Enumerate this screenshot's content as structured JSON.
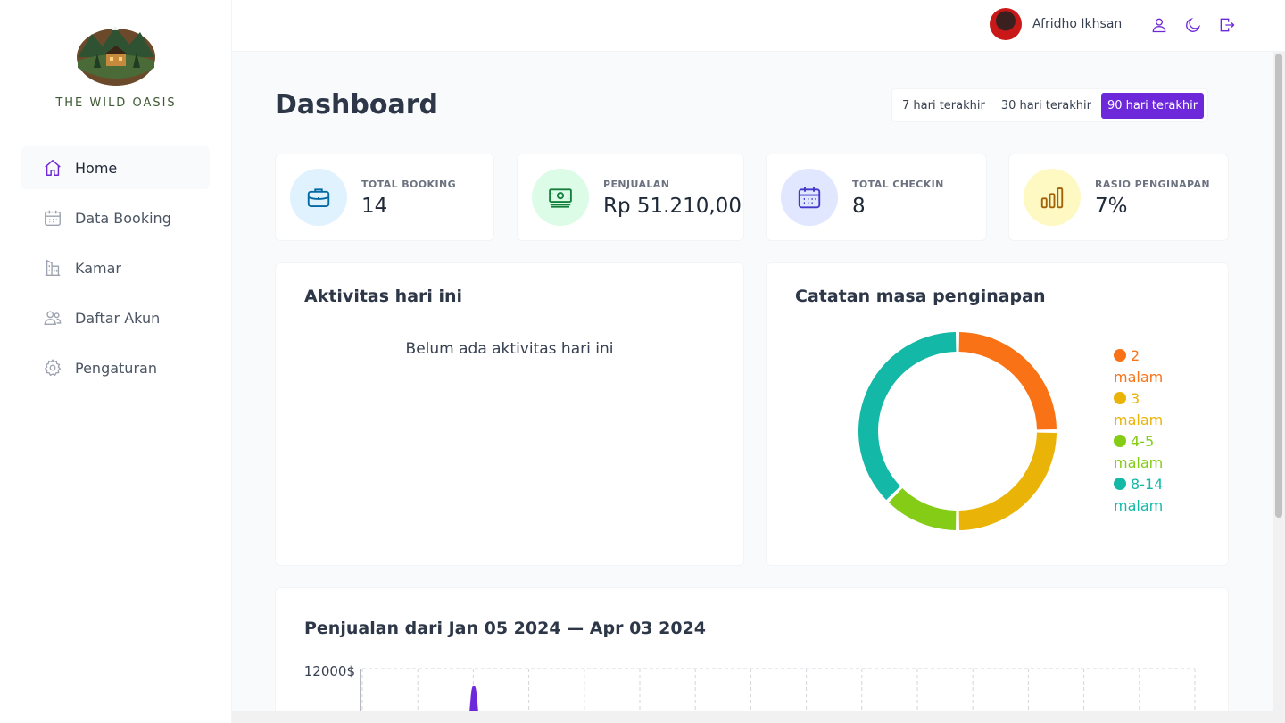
{
  "brand": {
    "name": "THE WILD OASIS"
  },
  "sidebar": {
    "items": [
      {
        "label": "Home",
        "icon": "home-icon",
        "active": true
      },
      {
        "label": "Data Booking",
        "icon": "calendar-icon",
        "active": false
      },
      {
        "label": "Kamar",
        "icon": "building-icon",
        "active": false
      },
      {
        "label": "Daftar Akun",
        "icon": "users-icon",
        "active": false
      },
      {
        "label": "Pengaturan",
        "icon": "gear-icon",
        "active": false
      }
    ]
  },
  "header": {
    "user_name": "Afridho Ikhsan",
    "icons": [
      "user-icon",
      "moon-icon",
      "logout-icon"
    ]
  },
  "page": {
    "title": "Dashboard"
  },
  "filter": {
    "options": [
      "7 hari terakhir",
      "30 hari terakhir",
      "90 hari terakhir"
    ],
    "selected": "90 hari terakhir"
  },
  "stats": [
    {
      "title": "TOTAL BOOKING",
      "value": "14",
      "icon": "briefcase-icon",
      "color": "#0369a1",
      "bg": "#e0f2fe"
    },
    {
      "title": "PENJUALAN",
      "value": "Rp 51.210,00",
      "icon": "banknotes-icon",
      "color": "#15803d",
      "bg": "#dcfce7"
    },
    {
      "title": "TOTAL CHECKIN",
      "value": "8",
      "icon": "calendar-days-icon",
      "color": "#4338ca",
      "bg": "#e0e7ff"
    },
    {
      "title": "RASIO PENGINAPAN",
      "value": "7%",
      "icon": "chart-bar-icon",
      "color": "#a16207",
      "bg": "#fef9c3"
    }
  ],
  "activity": {
    "title": "Aktivitas hari ini",
    "empty_message": "Belum ada aktivitas hari ini"
  },
  "stay_duration": {
    "title": "Catatan masa penginapan",
    "chart_data": {
      "type": "pie",
      "categories": [
        "2 malam",
        "3 malam",
        "4-5 malam",
        "8-14 malam"
      ],
      "values": [
        3,
        3,
        1.5,
        4.5
      ],
      "colors": [
        "#f97316",
        "#eab308",
        "#84cc16",
        "#14b8a6"
      ],
      "legend": "right"
    }
  },
  "sales": {
    "title": "Penjualan dari Jan 05 2024 — Apr 03 2024",
    "chart_data": {
      "type": "area",
      "y_tick_labels": [
        "12000$"
      ],
      "series_color": "#6d28d9",
      "grid": true
    }
  }
}
